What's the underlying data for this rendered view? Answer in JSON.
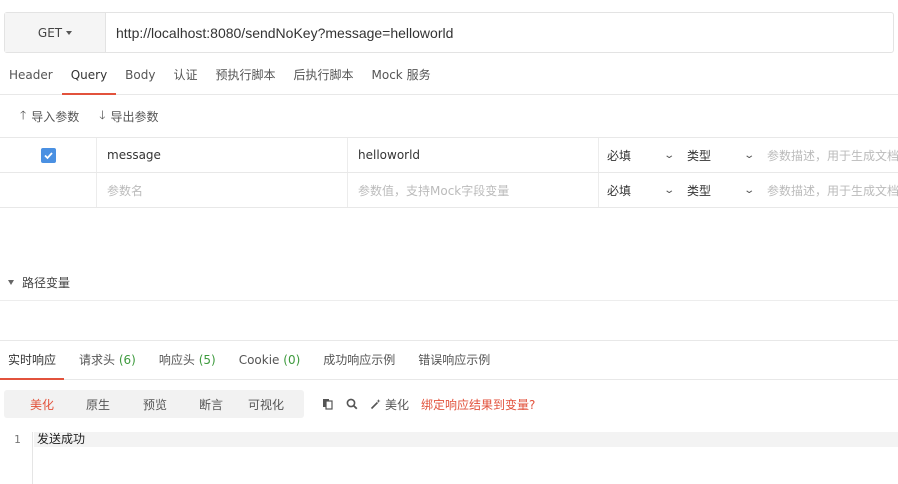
{
  "request": {
    "method": "GET",
    "url": "http://localhost:8080/sendNoKey?message=helloworld"
  },
  "req_tabs": [
    {
      "label": "Header"
    },
    {
      "label": "Query"
    },
    {
      "label": "Body"
    },
    {
      "label": "认证"
    },
    {
      "label": "预执行脚本"
    },
    {
      "label": "后执行脚本"
    },
    {
      "label": "Mock 服务"
    }
  ],
  "active_req_tab": "Query",
  "param_actions": {
    "import_label": "导入参数",
    "export_label": "导出参数"
  },
  "params": {
    "rows": [
      {
        "checked": true,
        "name": "message",
        "value": "helloworld",
        "required": "必填",
        "type": "类型",
        "desc_placeholder": "参数描述，用于生成文档"
      }
    ],
    "new_row": {
      "name_placeholder": "参数名",
      "value_placeholder": "参数值，支持Mock字段变量",
      "required": "必填",
      "type": "类型",
      "desc_placeholder": "参数描述，用于生成文档"
    }
  },
  "path_vars": {
    "label": "路径变量"
  },
  "res_tabs": [
    {
      "label": "实时响应",
      "count": ""
    },
    {
      "label": "请求头",
      "count": "(6)"
    },
    {
      "label": "响应头",
      "count": "(5)"
    },
    {
      "label": "Cookie",
      "count": "(0)"
    },
    {
      "label": "成功响应示例",
      "count": ""
    },
    {
      "label": "错误响应示例",
      "count": ""
    }
  ],
  "view_modes": [
    "美化",
    "原生",
    "预览",
    "断言",
    "可视化"
  ],
  "active_view_mode": "美化",
  "tools": {
    "beautify_label": "美化",
    "bind_link": "绑定响应结果到变量?"
  },
  "response_body": {
    "line_number": "1",
    "text": "发送成功"
  },
  "colors": {
    "accent": "#e2523c",
    "checkbox": "#4a90e2",
    "count_green": "#3d9a3d"
  }
}
